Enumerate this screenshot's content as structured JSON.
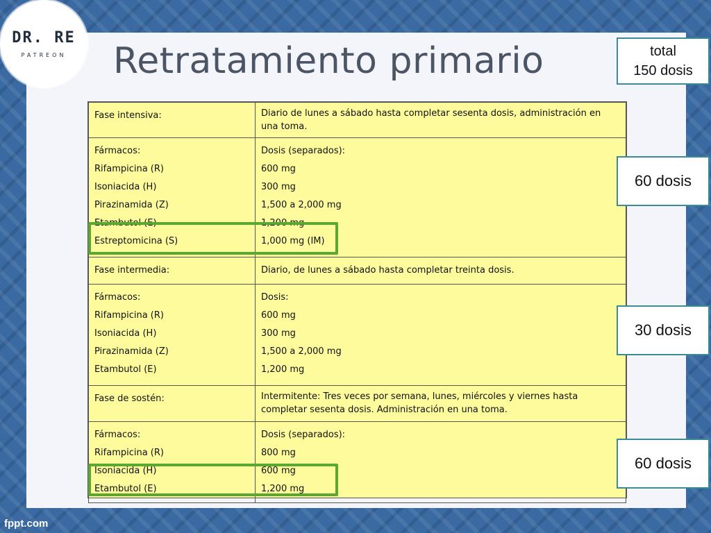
{
  "logo": {
    "brand": "DR. RE",
    "subtitle": "PATREON"
  },
  "title": "Retratamiento primario",
  "table": {
    "rows": [
      {
        "left": [
          "Fase intensiva:"
        ],
        "right": [
          "Diario de lunes a sábado hasta completar sesenta dosis, administración en",
          "una toma."
        ]
      },
      {
        "left": [
          "Fármacos:",
          "Rifampicina (R)",
          "Isoniacida (H)",
          "Pirazinamida (Z)",
          "Etambutol (E)",
          "Estreptomicina (S)"
        ],
        "right": [
          "Dosis (separados):",
          "600 mg",
          "300 mg",
          "1,500 a 2,000 mg",
          "1,200 mg",
          "1,000 mg (IM)"
        ]
      },
      {
        "left": [
          "Fase intermedia:"
        ],
        "right": [
          "Diario, de lunes a sábado hasta completar treinta dosis."
        ]
      },
      {
        "left": [
          "Fármacos:",
          "Rifampicina (R)",
          "Isoniacida (H)",
          "Pirazinamida (Z)",
          "Etambutol (E)"
        ],
        "right": [
          "Dosis:",
          "600 mg",
          "300 mg",
          "1,500 a 2,000 mg",
          "1,200 mg"
        ]
      },
      {
        "left": [
          "Fase de sostén:"
        ],
        "right": [
          "Intermitente: Tres veces por semana, lunes, miércoles y viernes hasta",
          "completar sesenta dosis. Administración en una toma."
        ]
      },
      {
        "left": [
          "Fármacos:",
          "Rifampicina (R)",
          "Isoniacida (H)",
          "Etambutol (E)"
        ],
        "right": [
          "Dosis (separados):",
          "800 mg",
          "600 mg",
          "1,200 mg"
        ]
      }
    ]
  },
  "side_boxes": {
    "total": {
      "line1": "total",
      "line2": "150 dosis"
    },
    "intensive": "60 dosis",
    "intermediate": "30 dosis",
    "maintenance": "60 dosis"
  },
  "highlight_color": "#5aa832",
  "footer": "fppt.com"
}
